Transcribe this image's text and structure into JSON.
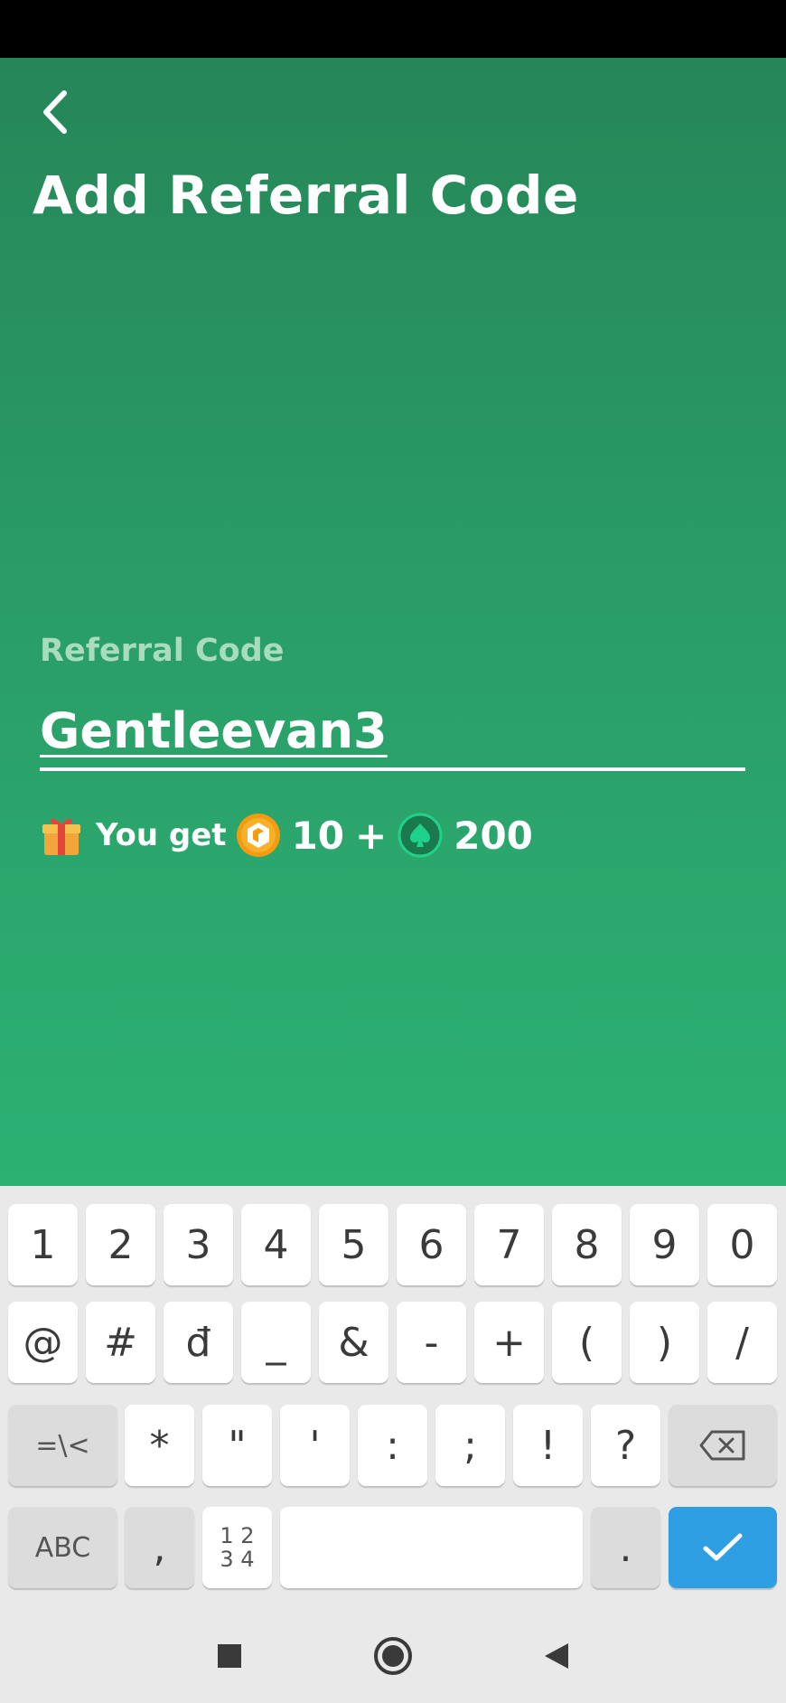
{
  "header": {
    "title": "Add Referral Code"
  },
  "form": {
    "label": "Referral Code",
    "value": "Gentleevan3"
  },
  "reward": {
    "gift_icon": "gift-icon",
    "text": "You get",
    "coin_amount": "10",
    "plus": "+",
    "chip_amount": "200",
    "coin_color": "#f39c12",
    "chip_color": "#1fd18a"
  },
  "keyboard": {
    "row1": [
      "1",
      "2",
      "3",
      "4",
      "5",
      "6",
      "7",
      "8",
      "9",
      "0"
    ],
    "row2": [
      "@",
      "#",
      "đ",
      "_",
      "&",
      "-",
      "+",
      "(",
      ")",
      "/"
    ],
    "row3_symbols_key": "=\\<",
    "row3": [
      "*",
      "\"",
      "'",
      ":",
      ";",
      "!",
      "?"
    ],
    "abc_key": "ABC",
    "comma_key": ",",
    "numpad_key": "1 2\n3 4",
    "period_key": ".",
    "accent_color": "#2f9fe3"
  }
}
